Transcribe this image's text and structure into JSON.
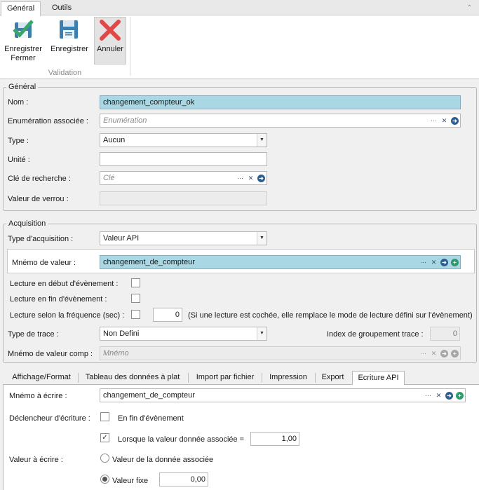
{
  "ribbon": {
    "tabs": [
      "Général",
      "Outils"
    ],
    "buttons": [
      {
        "label": "Enregistrer\nFermer",
        "icon": "save-close-icon"
      },
      {
        "label": "Enregistrer",
        "icon": "floppy-disk-icon"
      },
      {
        "label": "Annuler",
        "icon": "red-x-icon"
      }
    ],
    "group_label": "Validation"
  },
  "general": {
    "legend": "Général",
    "nom_label": "Nom :",
    "nom_value": "changement_compteur_ok",
    "enum_label": "Enumération associée :",
    "enum_placeholder": "Enumération",
    "type_label": "Type :",
    "type_value": "Aucun",
    "unite_label": "Unité :",
    "unite_value": "",
    "cle_label": "Clé de recherche :",
    "cle_placeholder": "Clé",
    "verrou_label": "Valeur de verrou :",
    "verrou_value": ""
  },
  "acquisition": {
    "legend": "Acquisition",
    "type_label": "Type d'acquisition :",
    "type_value": "Valeur API",
    "mnemo_label": "Mnémo de valeur :",
    "mnemo_value": "changement_de_compteur",
    "lecture_debut_label": "Lecture en début d'évènement :",
    "lecture_debut_checked": false,
    "lecture_fin_label": "Lecture en fin d'évènement :",
    "lecture_fin_checked": false,
    "lecture_freq_label": "Lecture selon la fréquence (sec) :",
    "lecture_freq_checked": false,
    "lecture_freq_value": "0",
    "lecture_note": "(Si une lecture est cochée, elle remplace le mode de lecture défini sur l'évènement)",
    "trace_label": "Type de trace :",
    "trace_value": "Non Defini",
    "index_label": "Index de groupement trace :",
    "index_value": "0",
    "mnemo_comp_label": "Mnémo de valeur comp :",
    "mnemo_comp_placeholder": "Mnémo"
  },
  "tabs": [
    "Affichage/Format",
    "Tableau des données à plat",
    "Import par fichier",
    "Impression",
    "Export",
    "Ecriture API"
  ],
  "active_tab": "Ecriture API",
  "ecriture": {
    "mnemo_label": "Mnémo à écrire :",
    "mnemo_value": "changement_de_compteur",
    "declencheur_label": "Déclencheur d'écriture :",
    "fin_label": "En fin d'évènement",
    "fin_checked": false,
    "lorsque_label": "Lorsque la valeur donnée associée =",
    "lorsque_checked": true,
    "lorsque_value": "1,00",
    "valeur_label": "Valeur à écrire :",
    "radio_donnee_label": "Valeur de la donnée associée",
    "radio_donnee_selected": false,
    "radio_fixe_label": "Valeur fixe",
    "radio_fixe_selected": true,
    "fixe_value": "0,00"
  }
}
